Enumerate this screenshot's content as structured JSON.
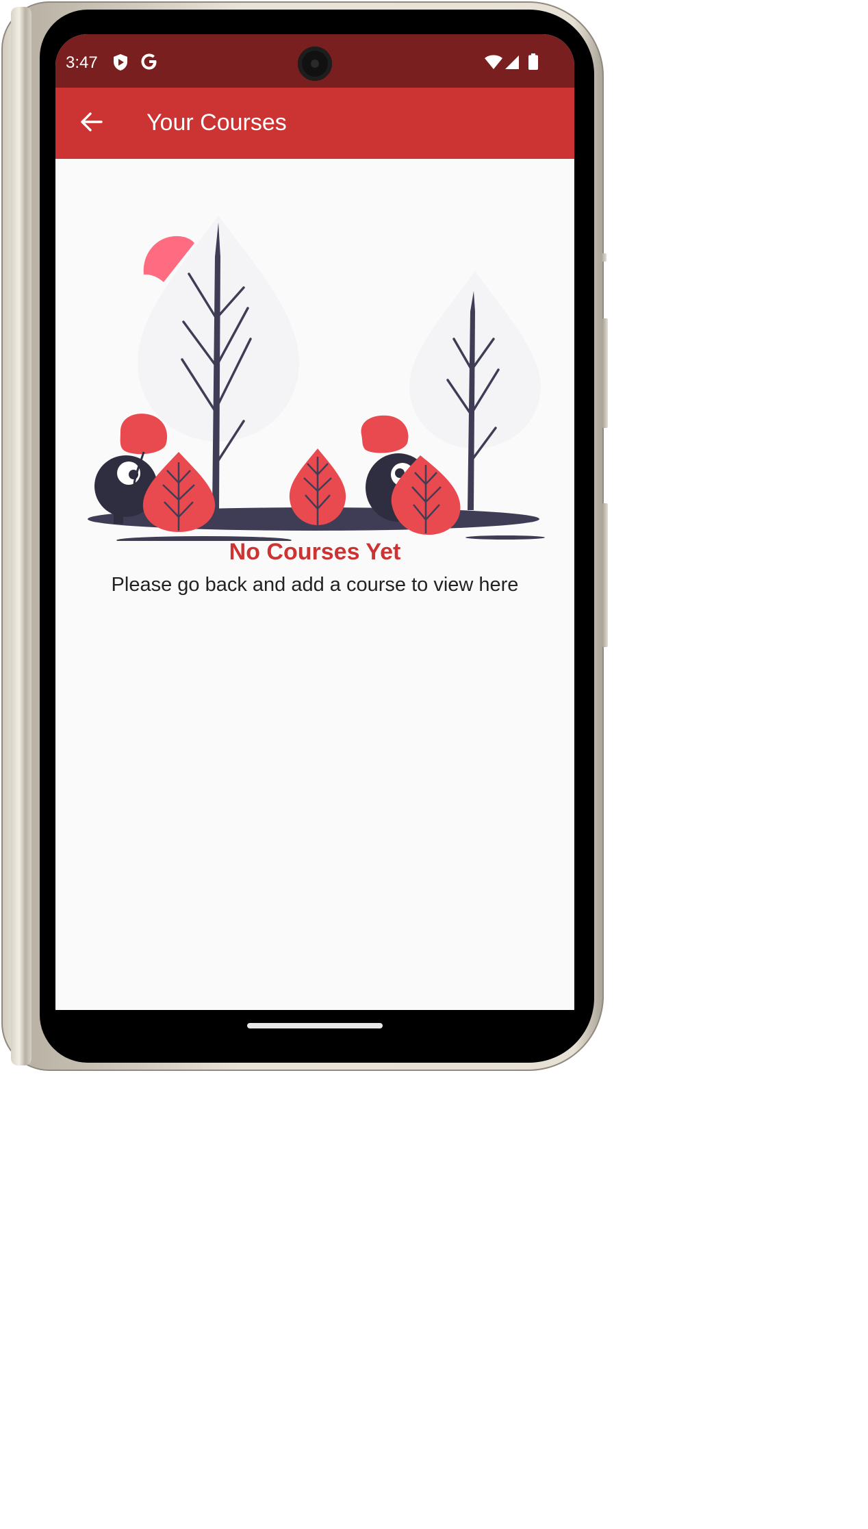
{
  "status_bar": {
    "time": "3:47",
    "left_icons": [
      "shield-play-icon",
      "google-g-icon"
    ],
    "right_icons": [
      "wifi-icon",
      "cellular-signal-icon",
      "battery-icon"
    ],
    "background_color": "#7a1f1f"
  },
  "app_bar": {
    "title": "Your Courses",
    "back_icon": "arrow-left-icon",
    "background_color": "#cc3333"
  },
  "empty_state": {
    "illustration": "trees-and-peeking-characters-illustration",
    "title": "No Courses Yet",
    "subtitle": "Please go back and add a course to view here",
    "accent_color": "#cc3333"
  }
}
